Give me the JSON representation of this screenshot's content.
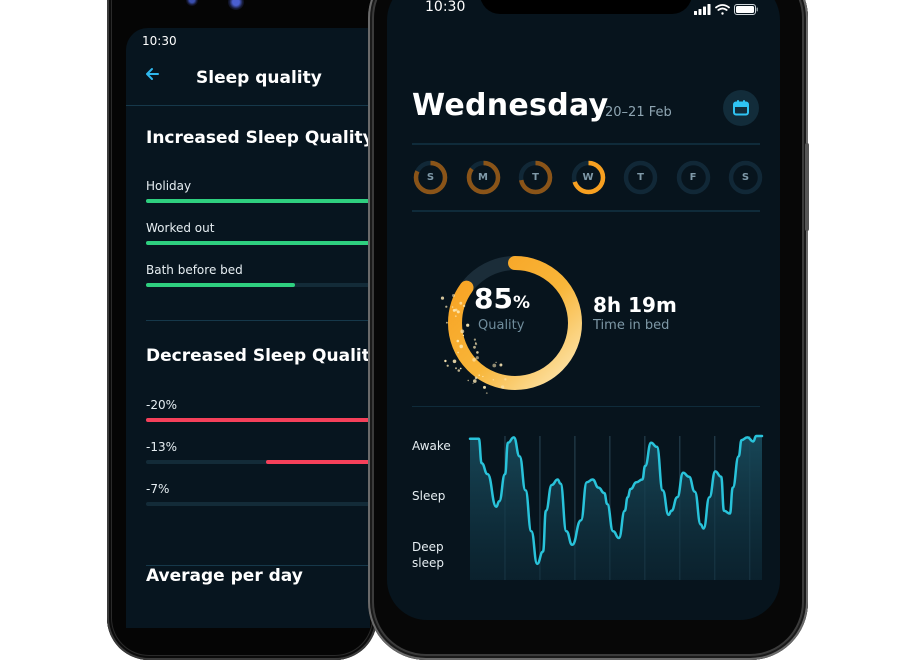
{
  "back_phone": {
    "status_time": "10:30",
    "header": {
      "back_icon": "arrow-left-icon",
      "title": "Sleep quality"
    },
    "increased": {
      "title": "Increased Sleep Quality",
      "items": [
        {
          "label": "Holiday",
          "fill": 1.0
        },
        {
          "label": "Worked out",
          "fill": 1.0
        },
        {
          "label": "Bath before bed",
          "fill": 0.62
        }
      ]
    },
    "decreased": {
      "title": "Decreased Sleep Quality",
      "items": [
        {
          "label": "-20%",
          "fill": 1.0
        },
        {
          "label": "-13%",
          "fill": 0.5
        },
        {
          "label": "-7%",
          "fill": 0.01
        }
      ]
    },
    "average_title": "Average per day"
  },
  "front_phone": {
    "status_time": "10:30",
    "status_icons": [
      "signal-icon",
      "wifi-icon",
      "battery-icon"
    ],
    "day_title": "Wednesday",
    "date_range": "20–21 Feb",
    "calendar_icon": "calendar-icon",
    "week": [
      {
        "letter": "S",
        "progress": 0.82,
        "state": "past"
      },
      {
        "letter": "M",
        "progress": 0.85,
        "state": "past"
      },
      {
        "letter": "T",
        "progress": 0.72,
        "state": "past"
      },
      {
        "letter": "W",
        "progress": 0.7,
        "state": "selected"
      },
      {
        "letter": "T",
        "progress": 0,
        "state": "future"
      },
      {
        "letter": "F",
        "progress": 0,
        "state": "future"
      },
      {
        "letter": "S",
        "progress": 0,
        "state": "future"
      }
    ],
    "quality": {
      "value": "85",
      "unit": "%",
      "label": "Quality",
      "fraction": 0.85
    },
    "time_in_bed": {
      "value": "8h 19m",
      "label": "Time in bed"
    },
    "colors": {
      "accent_orange": "#f7a020",
      "past_orange": "#8a5418",
      "line_cyan": "#29c3da",
      "green": "#2ecf7f",
      "red": "#f5405a"
    }
  },
  "chart_data": {
    "type": "area",
    "title": "",
    "xlabel": "",
    "ylabel": "",
    "y_categories": [
      "Deep sleep",
      "Sleep",
      "Awake"
    ],
    "ylim": [
      0,
      1
    ],
    "grid": "vertical",
    "gridline_count": 8,
    "x": [
      0,
      0.03,
      0.04,
      0.06,
      0.09,
      0.1,
      0.12,
      0.13,
      0.15,
      0.17,
      0.19,
      0.21,
      0.23,
      0.25,
      0.26,
      0.28,
      0.3,
      0.31,
      0.33,
      0.35,
      0.38,
      0.4,
      0.42,
      0.44,
      0.46,
      0.47,
      0.49,
      0.51,
      0.53,
      0.54,
      0.55,
      0.57,
      0.59,
      0.6,
      0.62,
      0.64,
      0.66,
      0.68,
      0.69,
      0.71,
      0.73,
      0.75,
      0.77,
      0.79,
      0.8,
      0.82,
      0.84,
      0.86,
      0.87,
      0.89,
      0.9,
      0.92,
      0.93,
      0.95,
      0.97,
      0.98,
      1.0
    ],
    "values": [
      0.98,
      0.98,
      0.8,
      0.72,
      0.48,
      0.52,
      0.72,
      0.95,
      0.99,
      0.85,
      0.6,
      0.3,
      0.06,
      0.15,
      0.45,
      0.64,
      0.68,
      0.65,
      0.3,
      0.2,
      0.38,
      0.66,
      0.68,
      0.62,
      0.58,
      0.5,
      0.3,
      0.25,
      0.45,
      0.55,
      0.61,
      0.66,
      0.68,
      0.78,
      0.95,
      0.92,
      0.6,
      0.42,
      0.45,
      0.55,
      0.73,
      0.7,
      0.59,
      0.35,
      0.32,
      0.55,
      0.74,
      0.7,
      0.45,
      0.43,
      0.62,
      0.85,
      0.97,
      0.99,
      0.96,
      1.0,
      1.0
    ]
  }
}
